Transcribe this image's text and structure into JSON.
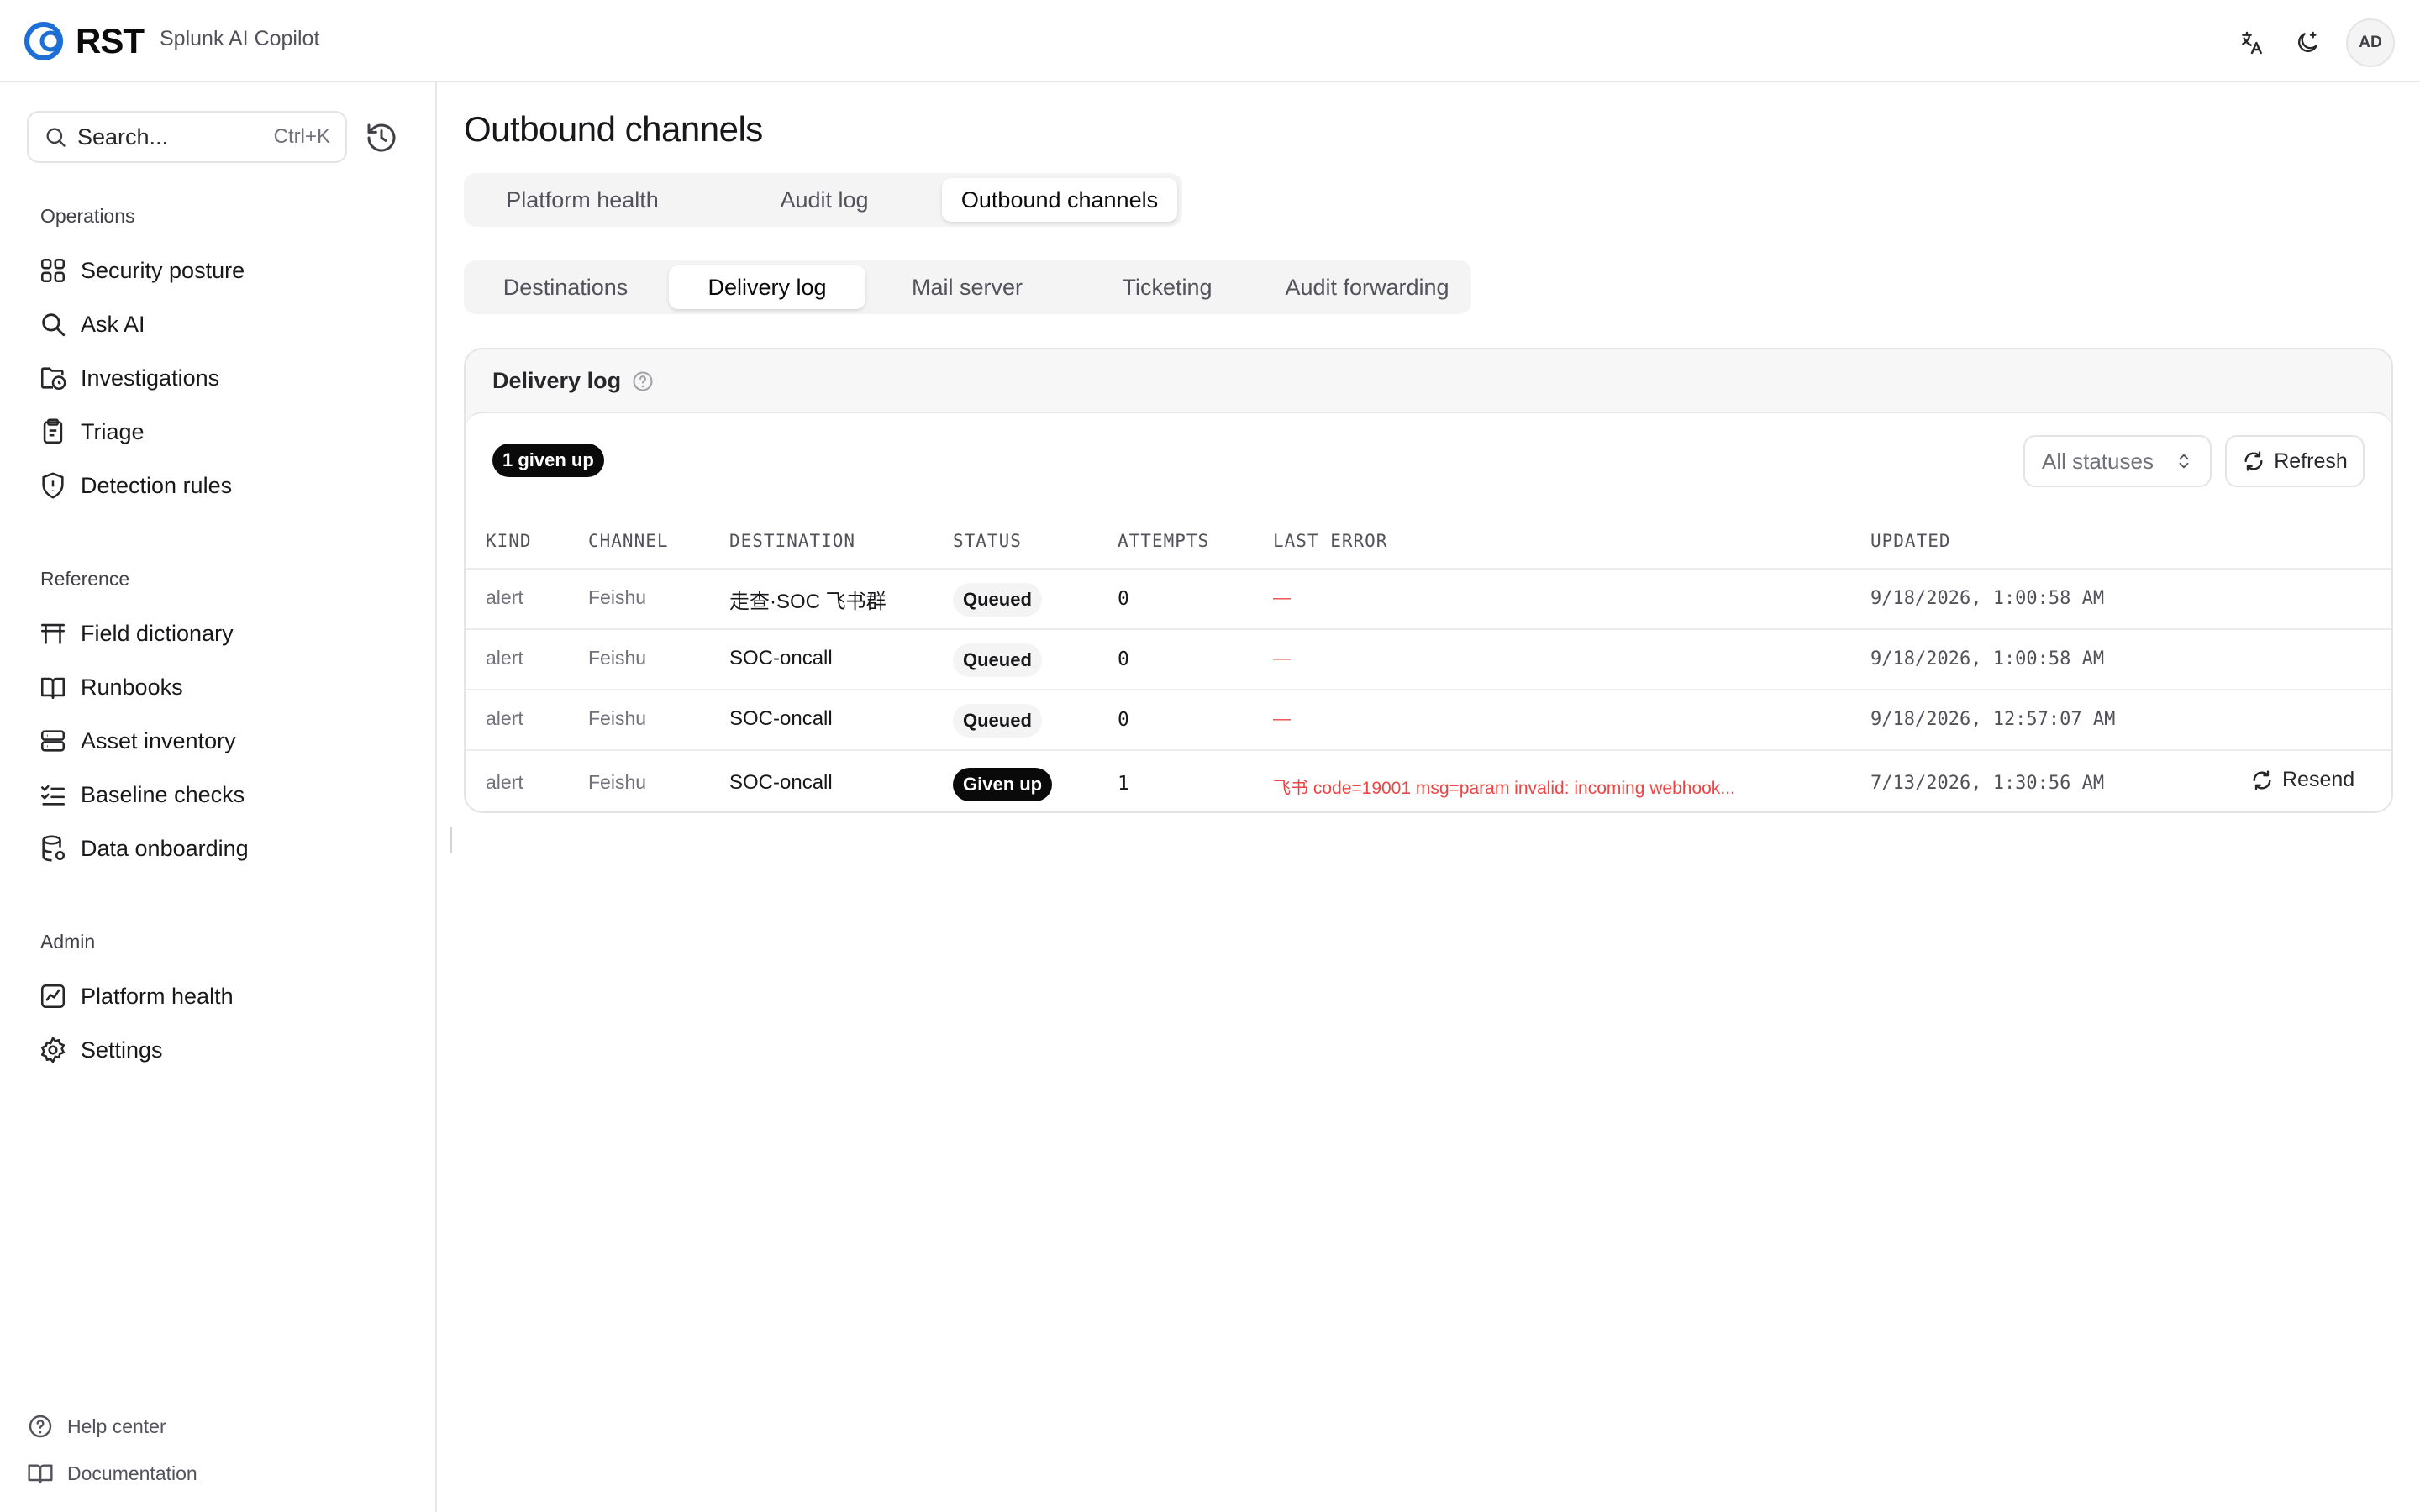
{
  "header": {
    "logo_text": "RST",
    "app_name": "Splunk AI Copilot",
    "avatar_initials": "AD",
    "icons": [
      "translate-icon",
      "theme-toggle-icon"
    ]
  },
  "sidebar": {
    "search": {
      "placeholder": "Search...",
      "shortcut": "Ctrl+K"
    },
    "sections": [
      {
        "title": "Operations",
        "items": [
          {
            "label": "Security posture",
            "icon": "grid-icon"
          },
          {
            "label": "Ask AI",
            "icon": "search-icon"
          },
          {
            "label": "Investigations",
            "icon": "folder-clock-icon"
          },
          {
            "label": "Triage",
            "icon": "clipboard-icon"
          },
          {
            "label": "Detection rules",
            "icon": "shield-icon"
          }
        ]
      },
      {
        "title": "Reference",
        "items": [
          {
            "label": "Field dictionary",
            "icon": "table-icon"
          },
          {
            "label": "Runbooks",
            "icon": "book-icon"
          },
          {
            "label": "Asset inventory",
            "icon": "server-icon"
          },
          {
            "label": "Baseline checks",
            "icon": "list-checks-icon"
          },
          {
            "label": "Data onboarding",
            "icon": "database-icon"
          }
        ]
      },
      {
        "title": "Admin",
        "items": [
          {
            "label": "Platform health",
            "icon": "chart-icon"
          },
          {
            "label": "Settings",
            "icon": "gear-icon"
          }
        ]
      }
    ],
    "footer": [
      {
        "label": "Help center",
        "icon": "help-circle-icon"
      },
      {
        "label": "Documentation",
        "icon": "book-open-icon"
      }
    ]
  },
  "main": {
    "title": "Outbound channels",
    "tabs": [
      "Platform health",
      "Audit log",
      "Outbound channels"
    ],
    "active_tab": "Outbound channels",
    "subtabs": [
      "Destinations",
      "Delivery log",
      "Mail server",
      "Ticketing",
      "Audit forwarding"
    ],
    "active_subtab": "Delivery log",
    "card": {
      "title": "Delivery log",
      "summary_badge": "1 given up",
      "status_filter": "All statuses",
      "refresh_label": "Refresh",
      "columns": [
        "KIND",
        "CHANNEL",
        "DESTINATION",
        "STATUS",
        "ATTEMPTS",
        "LAST ERROR",
        "UPDATED"
      ],
      "rows": [
        {
          "kind": "alert",
          "channel": "Feishu",
          "destination": "走查·SOC 飞书群",
          "status": "Queued",
          "attempts": "0",
          "last_error": "—",
          "updated": "9/18/2026, 1:00:58 AM"
        },
        {
          "kind": "alert",
          "channel": "Feishu",
          "destination": "SOC-oncall",
          "status": "Queued",
          "attempts": "0",
          "last_error": "—",
          "updated": "9/18/2026, 1:00:58 AM"
        },
        {
          "kind": "alert",
          "channel": "Feishu",
          "destination": "SOC-oncall",
          "status": "Queued",
          "attempts": "0",
          "last_error": "—",
          "updated": "9/18/2026, 12:57:07 AM"
        },
        {
          "kind": "alert",
          "channel": "Feishu",
          "destination": "SOC-oncall",
          "status": "Given up",
          "attempts": "1",
          "last_error": "飞书 code=19001 msg=param invalid: incoming webhook...",
          "updated": "7/13/2026, 1:30:56 AM",
          "action": "Resend"
        }
      ]
    }
  },
  "colors": {
    "accent_blue": "#1d6fd6",
    "error_red": "#ef4444",
    "badge_dark": "#0a0a0a",
    "border": "#e4e4e7"
  }
}
